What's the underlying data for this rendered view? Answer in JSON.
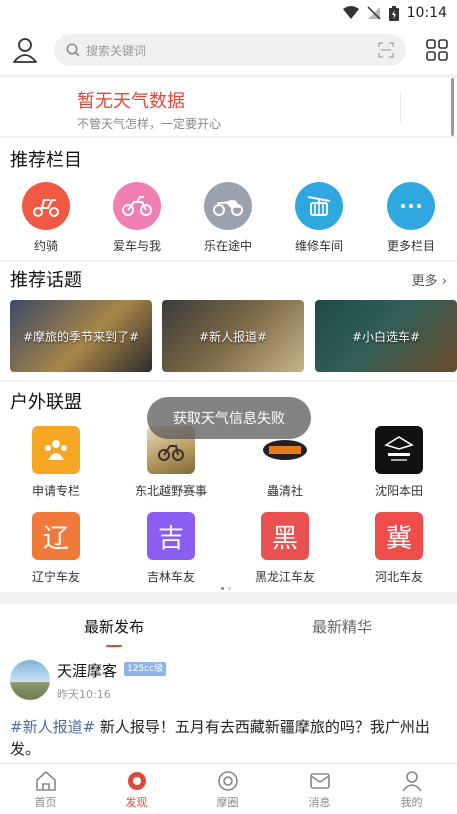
{
  "status_bar": {
    "time": "10:14"
  },
  "search": {
    "placeholder": "搜索关键词"
  },
  "weather": {
    "title": "暂无天气数据",
    "subtitle": "不管天气怎样，一定要开心"
  },
  "columns": {
    "title": "推荐栏目",
    "items": [
      {
        "label": "约骑",
        "color": "#f05a44",
        "icon": "scooter-icon"
      },
      {
        "label": "爱车与我",
        "color": "#f07fb4",
        "icon": "dirtbike-icon"
      },
      {
        "label": "乐在途中",
        "color": "#9aa3ad",
        "icon": "motorcycle-icon"
      },
      {
        "label": "维修车间",
        "color": "#2fa8e2",
        "icon": "cable-car-icon"
      },
      {
        "label": "更多栏目",
        "color": "#2fa8e2",
        "icon": "more-dots-icon"
      }
    ]
  },
  "topics": {
    "title": "推荐话题",
    "more": "更多",
    "items": [
      {
        "tag": "#摩旅的季节来到了#"
      },
      {
        "tag": "#新人报道#"
      },
      {
        "tag": "#小白选车#"
      }
    ]
  },
  "alliance": {
    "title": "户外联盟",
    "items": [
      {
        "label": "申请专栏",
        "color": "#f5a623",
        "glyph": ""
      },
      {
        "label": "东北越野赛事",
        "color": "#c9b07a",
        "glyph": ""
      },
      {
        "label": "蟲清社",
        "color": "#222222",
        "glyph": ""
      },
      {
        "label": "沈阳本田",
        "color": "#111111",
        "glyph": ""
      },
      {
        "label": "辽宁车友",
        "color": "#f07a3a",
        "glyph": "辽"
      },
      {
        "label": "吉林车友",
        "color": "#8a5cf0",
        "glyph": "吉"
      },
      {
        "label": "黑龙江车友",
        "color": "#e95050",
        "glyph": "黑"
      },
      {
        "label": "河北车友",
        "color": "#ef4c4c",
        "glyph": "冀"
      }
    ]
  },
  "toast": "获取天气信息失败",
  "feed": {
    "tabs": [
      "最新发布",
      "最新精华"
    ],
    "post": {
      "author": "天涯摩客",
      "time": "昨天10:16",
      "hashtag": "#新人报道#",
      "text": " 新人报导！五月有去西藏新疆摩旅的吗？我广州出发。"
    }
  },
  "bottom_nav": {
    "items": [
      {
        "label": "首页",
        "icon": "home-icon",
        "active": false
      },
      {
        "label": "发现",
        "icon": "discover-icon",
        "active": true
      },
      {
        "label": "摩圈",
        "icon": "circle-icon",
        "active": false
      },
      {
        "label": "消息",
        "icon": "message-icon",
        "active": false
      },
      {
        "label": "我的",
        "icon": "profile-icon",
        "active": false
      }
    ]
  },
  "colors": {
    "accent": "#e0483b",
    "hashtag": "#4a6fa5"
  }
}
